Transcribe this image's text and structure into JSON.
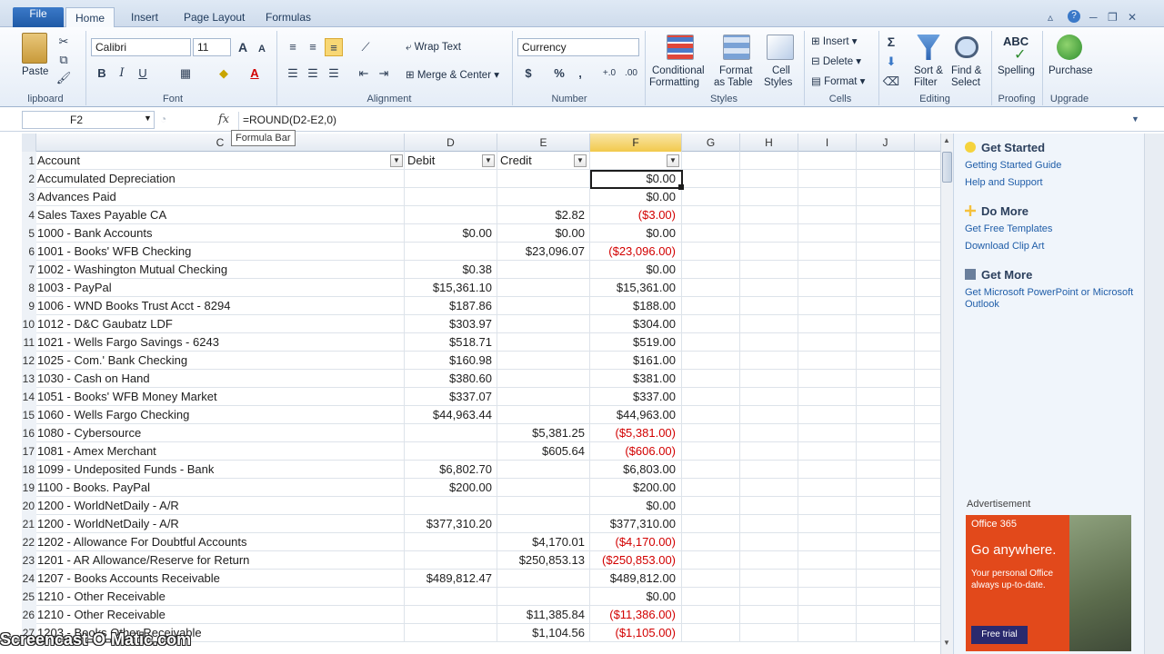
{
  "tabs": [
    "File",
    "Home",
    "Insert",
    "Page Layout",
    "Formulas"
  ],
  "ribbon": {
    "clipboard": {
      "paste": "Paste",
      "label": "lipboard"
    },
    "font": {
      "name": "Calibri",
      "size": "11",
      "label": "Font",
      "bold": "B",
      "italic": "I",
      "underline": "U",
      "grow": "A",
      "shrink": "A",
      "color": "A"
    },
    "alignment": {
      "wrap": "Wrap Text",
      "merge": "Merge & Center",
      "label": "Alignment"
    },
    "number": {
      "format": "Currency",
      "dollar": "$",
      "percent": "%",
      "comma": ",",
      "label": "Number"
    },
    "styles": {
      "conditional": "Conditional",
      "conditional2": "Formatting",
      "format_table": "Format",
      "format_table2": "as Table",
      "cell_styles": "Cell",
      "cell_styles2": "Styles",
      "label": "Styles"
    },
    "cells": {
      "insert": "Insert",
      "delete": "Delete",
      "format": "Format",
      "label": "Cells"
    },
    "editing": {
      "sum": "Σ",
      "sort": "Sort &",
      "sort2": "Filter",
      "find": "Find &",
      "find2": "Select",
      "label": "Editing"
    },
    "proofing": {
      "icon_text": "ABC",
      "spelling": "Spelling",
      "label": "Proofing"
    },
    "upgrade": {
      "purchase": "Purchase",
      "label": "Upgrade"
    }
  },
  "formula_bar": {
    "name_box": "F2",
    "fx": "fx",
    "formula": "=ROUND(D2-E2,0)",
    "tooltip": "Formula Bar"
  },
  "columns": [
    "C",
    "D",
    "E",
    "F",
    "G",
    "H",
    "I",
    "J"
  ],
  "header_row": {
    "row": "1",
    "account": "Account",
    "debit": "Debit",
    "credit": "Credit",
    "f": ""
  },
  "rows": [
    {
      "n": "2",
      "account": "Accumulated Depreciation",
      "debit": "",
      "credit": "",
      "f": "$0.00",
      "neg": false
    },
    {
      "n": "3",
      "account": "Advances Paid",
      "debit": "",
      "credit": "",
      "f": "$0.00",
      "neg": false
    },
    {
      "n": "4",
      "account": "Sales Taxes Payable CA",
      "debit": "",
      "credit": "$2.82",
      "f": "($3.00)",
      "neg": true
    },
    {
      "n": "5",
      "account": "1000 - Bank Accounts",
      "debit": "$0.00",
      "credit": "$0.00",
      "f": "$0.00",
      "neg": false
    },
    {
      "n": "6",
      "account": "1001 - Books' WFB Checking",
      "debit": "",
      "credit": "$23,096.07",
      "f": "($23,096.00)",
      "neg": true
    },
    {
      "n": "7",
      "account": "1002 - Washington Mutual Checking",
      "debit": "$0.38",
      "credit": "",
      "f": "$0.00",
      "neg": false
    },
    {
      "n": "8",
      "account": "1003 - PayPal",
      "debit": "$15,361.10",
      "credit": "",
      "f": "$15,361.00",
      "neg": false
    },
    {
      "n": "9",
      "account": "1006 - WND Books Trust Acct - 8294",
      "debit": "$187.86",
      "credit": "",
      "f": "$188.00",
      "neg": false
    },
    {
      "n": "10",
      "account": "1012 - D&C Gaubatz LDF",
      "debit": "$303.97",
      "credit": "",
      "f": "$304.00",
      "neg": false
    },
    {
      "n": "11",
      "account": "1021 - Wells Fargo Savings - 6243",
      "debit": "$518.71",
      "credit": "",
      "f": "$519.00",
      "neg": false
    },
    {
      "n": "12",
      "account": "1025 - Com.' Bank Checking",
      "debit": "$160.98",
      "credit": "",
      "f": "$161.00",
      "neg": false
    },
    {
      "n": "13",
      "account": "1030 - Cash on Hand",
      "debit": "$380.60",
      "credit": "",
      "f": "$381.00",
      "neg": false
    },
    {
      "n": "14",
      "account": "1051 - Books' WFB Money Market",
      "debit": "$337.07",
      "credit": "",
      "f": "$337.00",
      "neg": false
    },
    {
      "n": "15",
      "account": "1060 - Wells Fargo Checking",
      "debit": "$44,963.44",
      "credit": "",
      "f": "$44,963.00",
      "neg": false
    },
    {
      "n": "16",
      "account": "1080 - Cybersource",
      "debit": "",
      "credit": "$5,381.25",
      "f": "($5,381.00)",
      "neg": true
    },
    {
      "n": "17",
      "account": "1081 - Amex Merchant",
      "debit": "",
      "credit": "$605.64",
      "f": "($606.00)",
      "neg": true
    },
    {
      "n": "18",
      "account": "1099 - Undeposited Funds - Bank",
      "debit": "$6,802.70",
      "credit": "",
      "f": "$6,803.00",
      "neg": false
    },
    {
      "n": "19",
      "account": "1100 - Books. PayPal",
      "debit": "$200.00",
      "credit": "",
      "f": "$200.00",
      "neg": false
    },
    {
      "n": "20",
      "account": "1200 - WorldNetDaily - A/R",
      "debit": "",
      "credit": "",
      "f": "$0.00",
      "neg": false
    },
    {
      "n": "21",
      "account": "1200 - WorldNetDaily - A/R",
      "debit": "$377,310.20",
      "credit": "",
      "f": "$377,310.00",
      "neg": false
    },
    {
      "n": "22",
      "account": "1202 - Allowance For Doubtful Accounts",
      "debit": "",
      "credit": "$4,170.01",
      "f": "($4,170.00)",
      "neg": true
    },
    {
      "n": "23",
      "account": "1201 - AR Allowance/Reserve for Return",
      "debit": "",
      "credit": "$250,853.13",
      "f": "($250,853.00)",
      "neg": true
    },
    {
      "n": "24",
      "account": "1207 - Books Accounts Receivable",
      "debit": "$489,812.47",
      "credit": "",
      "f": "$489,812.00",
      "neg": false
    },
    {
      "n": "25",
      "account": "1210 - Other Receivable",
      "debit": "",
      "credit": "",
      "f": "$0.00",
      "neg": false
    },
    {
      "n": "26",
      "account": "1210 - Other Receivable",
      "debit": "",
      "credit": "$11,385.84",
      "f": "($11,386.00)",
      "neg": true
    },
    {
      "n": "27",
      "account": "1203 - Books Other Receivable",
      "debit": "",
      "credit": "$1,104.56",
      "f": "($1,105.00)",
      "neg": true
    }
  ],
  "pane": {
    "get_started": "Get Started",
    "link_guide": "Getting Started Guide",
    "link_help": "Help and Support",
    "do_more": "Do More",
    "link_templates": "Get Free Templates",
    "link_clipart": "Download Clip Art",
    "get_more": "Get More",
    "link_ppt": "Get Microsoft PowerPoint or Microsoft",
    "link_ppt2": "Outlook",
    "ad_label": "Advertisement",
    "ad_brand": "Office 365",
    "ad_title": "Go anywhere.",
    "ad_body": "Your personal Office always up-to-date.",
    "ad_button": "Free trial"
  },
  "watermark": "Screencast-O-Matic.com",
  "colors": {
    "accent": "#1f5aa6",
    "negative": "#d20000",
    "selected_col": "#f2c94c",
    "ad": "#e2491b"
  }
}
